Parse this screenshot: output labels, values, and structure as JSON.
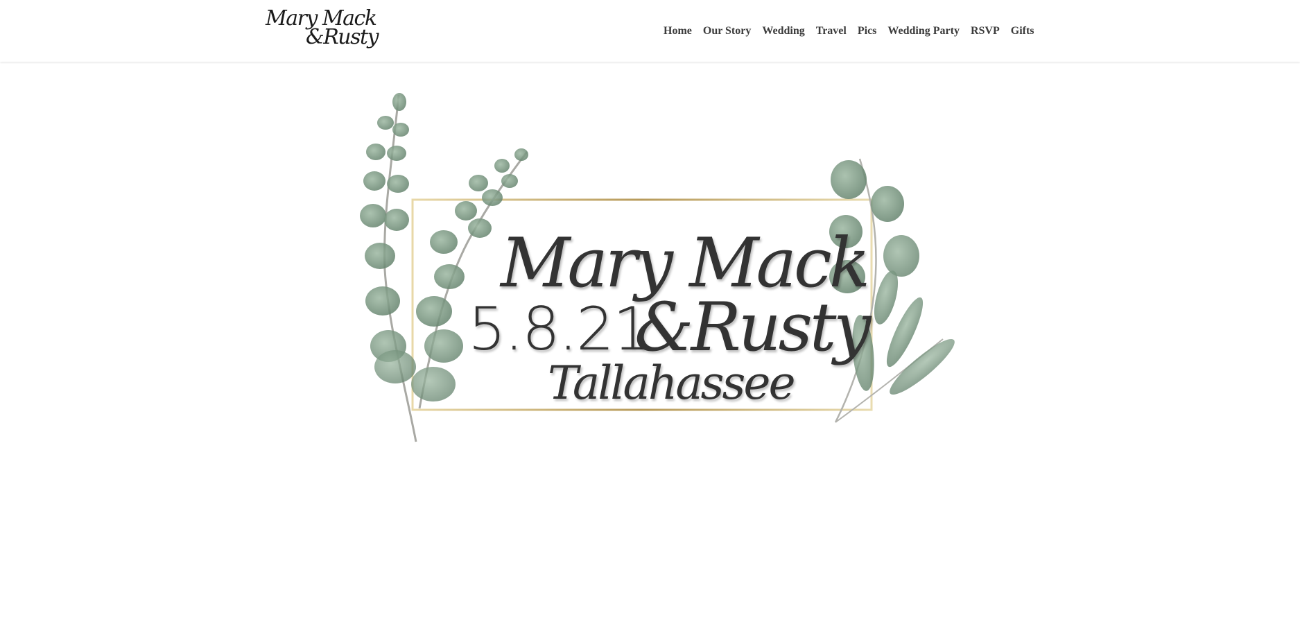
{
  "site": {
    "logo": {
      "line1": "Mary Mack",
      "line2": "&Rusty"
    },
    "nav": [
      {
        "label": "Home"
      },
      {
        "label": "Our Story"
      },
      {
        "label": "Wedding"
      },
      {
        "label": "Travel"
      },
      {
        "label": "Pics"
      },
      {
        "label": "Wedding Party"
      },
      {
        "label": "RSVP"
      },
      {
        "label": "Gifts"
      }
    ]
  },
  "hero": {
    "name_line1": "Mary Mack",
    "date": "5.8.21",
    "name_line2": "&Rusty",
    "city": "Tallahassee"
  },
  "colors": {
    "text": "#333333",
    "frame_gold": "#c9b27a",
    "leaf_green": "#6f8f78",
    "stem": "#a9a9a4",
    "background": "#ffffff"
  }
}
